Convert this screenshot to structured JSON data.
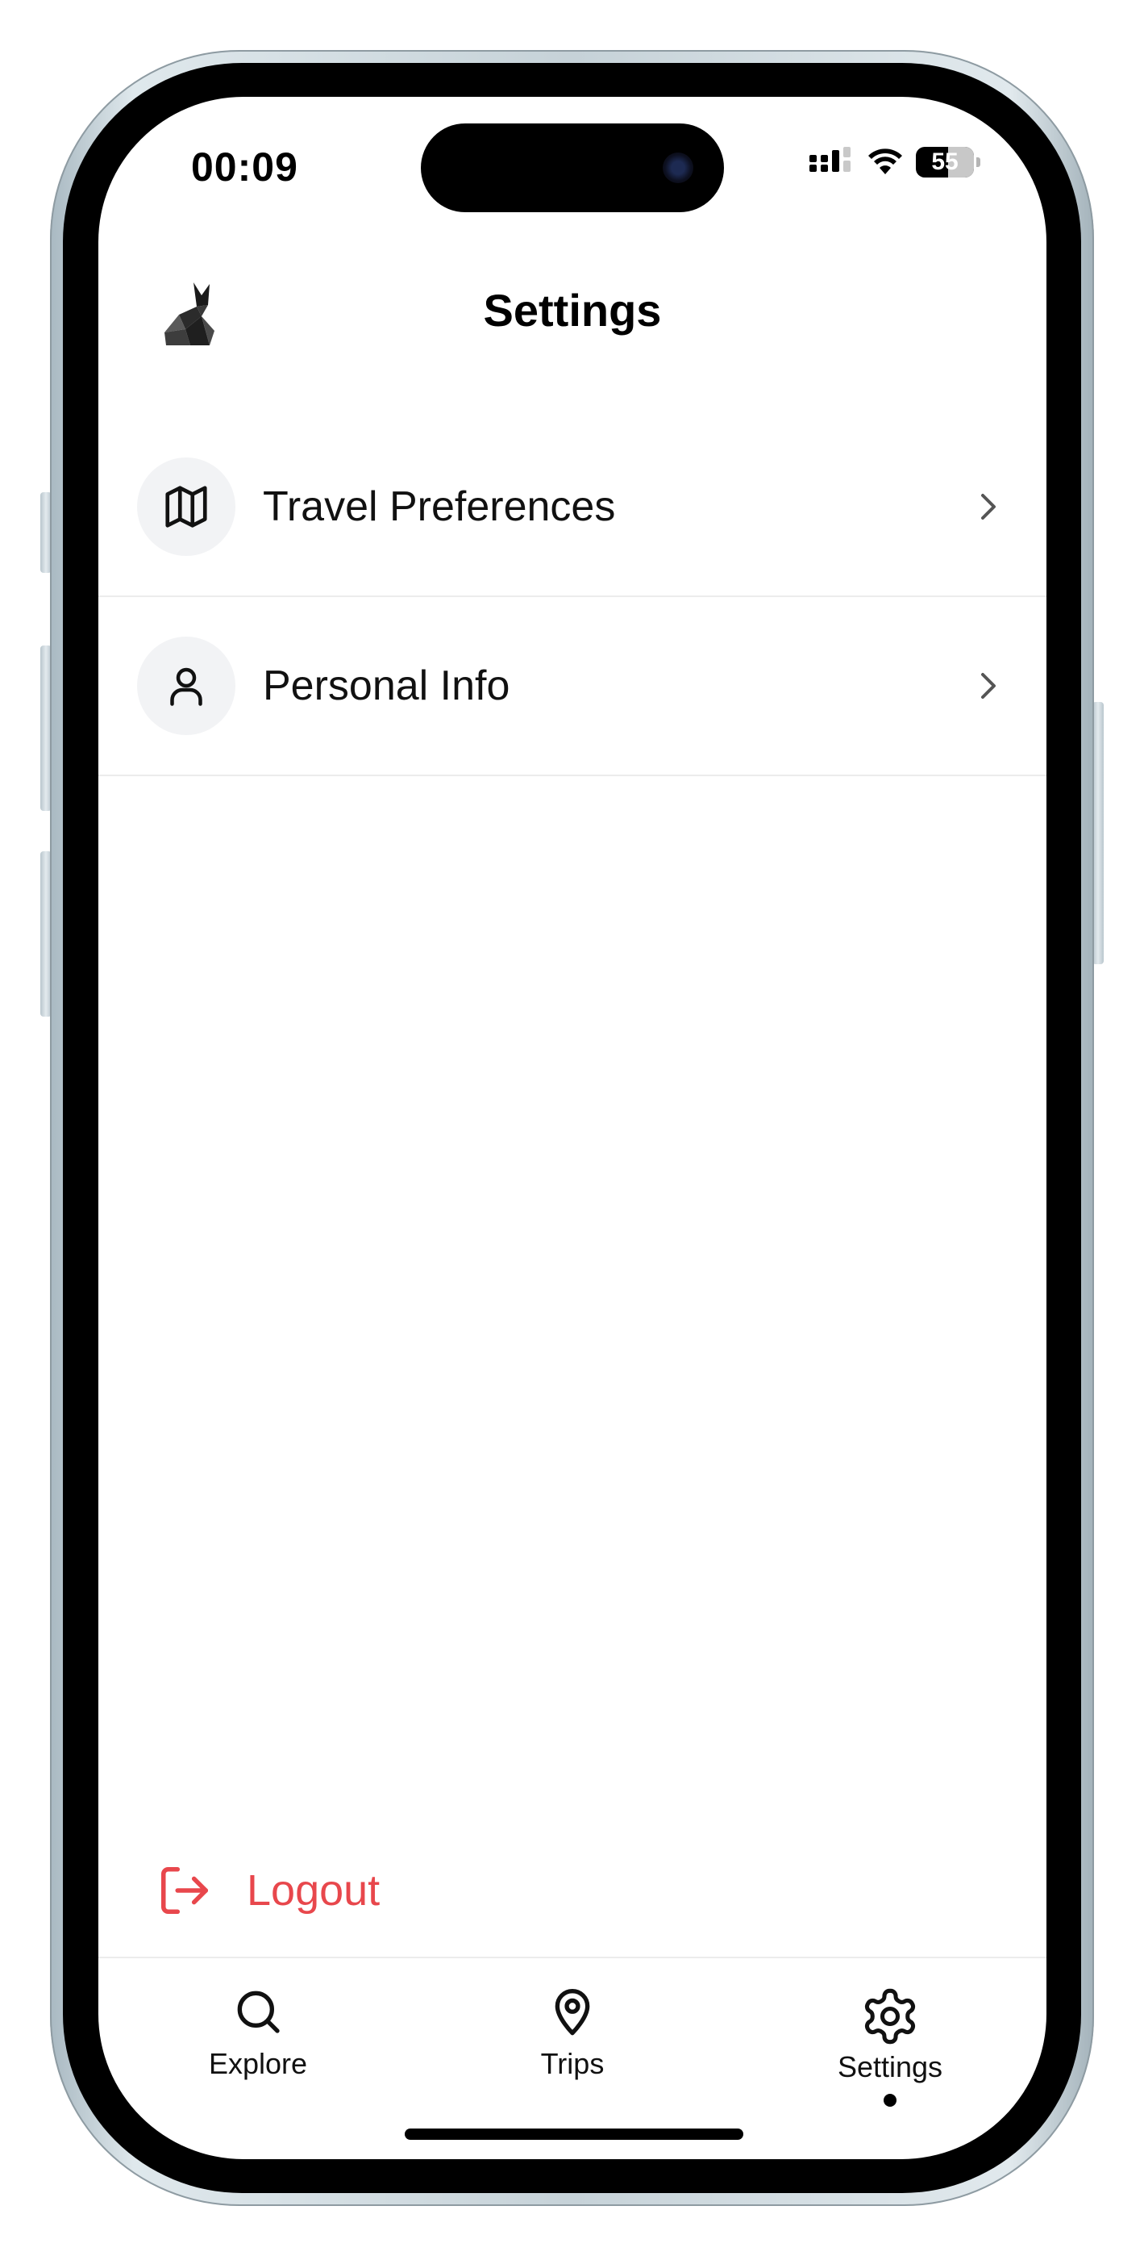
{
  "status_bar": {
    "time": "00:09",
    "battery_level": "55"
  },
  "header": {
    "title": "Settings",
    "logo_icon": "fox-logo-icon"
  },
  "settings_items": [
    {
      "label": "Travel Preferences",
      "icon": "map-icon"
    },
    {
      "label": "Personal Info",
      "icon": "user-icon"
    }
  ],
  "logout": {
    "label": "Logout",
    "icon": "logout-icon",
    "color": "#e8474c"
  },
  "tab_bar": {
    "tabs": [
      {
        "label": "Explore",
        "icon": "search-icon"
      },
      {
        "label": "Trips",
        "icon": "map-pin-icon"
      },
      {
        "label": "Settings",
        "icon": "gear-icon",
        "active": true
      }
    ]
  }
}
